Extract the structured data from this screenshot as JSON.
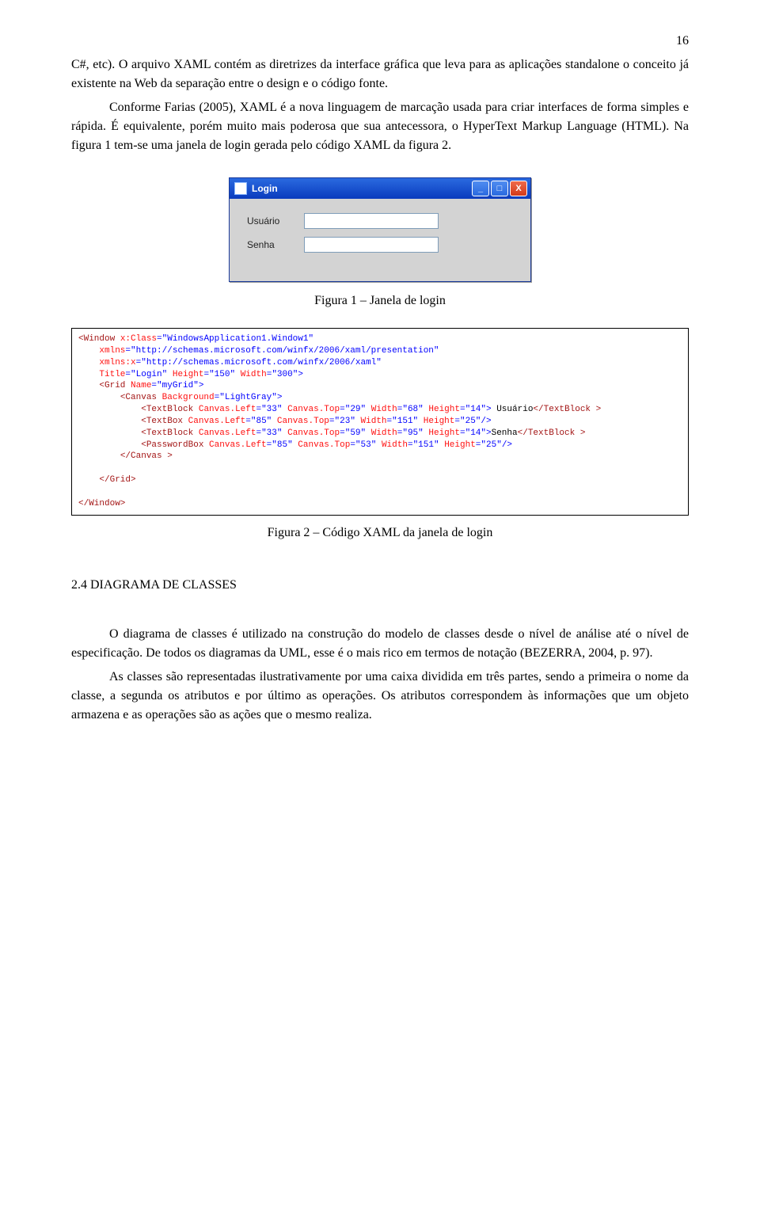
{
  "page_number": "16",
  "para1": "C#, etc). O arquivo XAML contém as diretrizes da interface gráfica que leva para as aplicações standalone o conceito já existente na Web da separação entre o design e o código fonte.",
  "para2": "Conforme Farias (2005), XAML é a nova linguagem de marcação usada para criar interfaces de forma simples e rápida. É equivalente, porém muito mais poderosa que sua antecessora, o HyperText Markup Language (HTML). Na figura 1 tem-se uma janela de login gerada pelo código XAML da figura 2.",
  "login_window": {
    "title": "Login",
    "labels": {
      "user": "Usuário",
      "password": "Senha"
    }
  },
  "caption1": "Figura 1 – Janela de login",
  "caption2": "Figura 2 – Código XAML da janela de login",
  "section_title": "2.4    DIAGRAMA DE CLASSES",
  "para3": "O diagrama de classes é utilizado na construção do modelo de classes desde o nível de análise até o nível de especificação. De todos os diagramas da UML, esse é o mais rico em termos de notação (BEZERRA, 2004, p. 97).",
  "para4": "As classes são representadas ilustrativamente por uma caixa dividida em três partes, sendo a primeira o nome da classe, a segunda os atributos e por último as operações. Os atributos correspondem às informações que um objeto armazena e as operações são as ações que o mesmo realiza.",
  "code": {
    "l1a": "<Window ",
    "l1b": "x:Class",
    "l1c": "\"WindowsApplication1.Window1\"",
    "l2a": "xmlns",
    "l2b": "\"http://schemas.microsoft.com/winfx/2006/xaml/presentation\"",
    "l3a": "xmlns:x",
    "l3b": "\"http://schemas.microsoft.com/winfx/2006/xaml\"",
    "l4a": "Title",
    "l4b": "\"Login\"",
    "l4c": "Height",
    "l4d": "\"150\"",
    "l4e": "Width",
    "l4f": "\"300\"",
    "l5a": "<Grid ",
    "l5b": "Name",
    "l5c": "\"myGrid\"",
    "l6a": "<Canvas ",
    "l6b": "Background",
    "l6c": "\"LightGray\"",
    "l7a": "<TextBlock ",
    "l7b": "Canvas.Left",
    "l7c": "\"33\"",
    "l7d": "Canvas.Top",
    "l7e": "\"29\"",
    "l7f": "Width",
    "l7g": "\"68\"",
    "l7h": "Height",
    "l7i": "\"14\"",
    "l7j": " Usuário",
    "l7k": "</TextBlock >",
    "l8a": "<TextBox ",
    "l8b": "Canvas.Left",
    "l8c": "\"85\"",
    "l8d": "Canvas.Top",
    "l8e": "\"23\"",
    "l8f": "Width",
    "l8g": "\"151\"",
    "l8h": "Height",
    "l8i": "\"25\"",
    "l9a": "<TextBlock ",
    "l9b": "Canvas.Left",
    "l9c": "\"33\"",
    "l9d": "Canvas.Top",
    "l9e": "\"59\"",
    "l9f": "Width",
    "l9g": "\"95\"",
    "l9h": "Height",
    "l9i": "\"14\"",
    "l9j": "Senha",
    "l9k": "</TextBlock >",
    "l10a": "<PasswordBox ",
    "l10b": "Canvas.Left",
    "l10c": "\"85\"",
    "l10d": "Canvas.Top",
    "l10e": "\"53\"",
    "l10f": "Width",
    "l10g": "\"151\"",
    "l10h": "Height",
    "l10i": "\"25\"",
    "l11": "</Canvas >",
    "l12": "</Grid>",
    "l13": "</Window>"
  }
}
